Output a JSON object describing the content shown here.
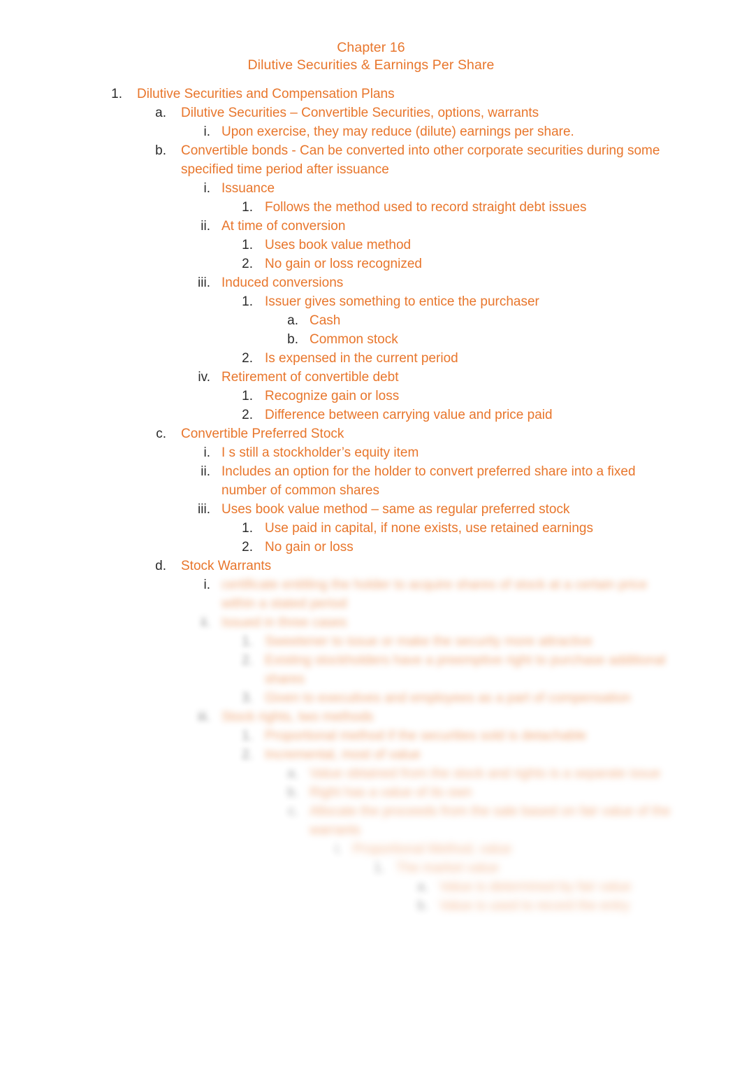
{
  "document": {
    "title_lines": [
      "Chapter 16",
      "Dilutive Securities & Earnings Per Share"
    ],
    "text_color": "#E8762C",
    "marker_color": "#2B2B2B",
    "background_color": "#FFFFFF"
  },
  "outline": [
    {
      "marker": "1.",
      "level": 1,
      "text": "Dilutive Securities and Compensation Plans",
      "blurred": false
    },
    {
      "marker": "a.",
      "level": 2,
      "text": "Dilutive Securities – Convertible Securities, options, warrants",
      "blurred": false
    },
    {
      "marker": "i.",
      "level": 3,
      "text": "Upon exercise, they may reduce (dilute) earnings per share.",
      "blurred": false
    },
    {
      "marker": "b.",
      "level": 2,
      "text": "Convertible bonds - Can be converted into other corporate securities during some specified time period after issuance",
      "blurred": false
    },
    {
      "marker": "i.",
      "level": 3,
      "text": "Issuance",
      "blurred": false
    },
    {
      "marker": "1.",
      "level": 4,
      "text": "Follows the method used to record straight debt issues",
      "blurred": false
    },
    {
      "marker": "ii.",
      "level": 3,
      "text": "At time of conversion",
      "blurred": false
    },
    {
      "marker": "1.",
      "level": 4,
      "text": "Uses book value method",
      "blurred": false
    },
    {
      "marker": "2.",
      "level": 4,
      "text": "No gain or loss recognized",
      "blurred": false
    },
    {
      "marker": "iii.",
      "level": 3,
      "text": "Induced conversions",
      "blurred": false
    },
    {
      "marker": "1.",
      "level": 4,
      "text": "Issuer gives something to entice the purchaser",
      "blurred": false
    },
    {
      "marker": "a.",
      "level": 5,
      "text": "Cash",
      "blurred": false
    },
    {
      "marker": "b.",
      "level": 5,
      "text": "Common stock",
      "blurred": false
    },
    {
      "marker": "2.",
      "level": 4,
      "text": "Is expensed in the current period",
      "blurred": false
    },
    {
      "marker": "iv.",
      "level": 3,
      "text": "Retirement of convertible debt",
      "blurred": false
    },
    {
      "marker": "1.",
      "level": 4,
      "text": "Recognize gain or loss",
      "blurred": false
    },
    {
      "marker": "2.",
      "level": 4,
      "text": "Difference between carrying value and price paid",
      "blurred": false
    },
    {
      "marker": "c.",
      "level": 2,
      "text": "Convertible Preferred Stock",
      "blurred": false
    },
    {
      "marker": "i.",
      "level": 3,
      "text": "I s still a stockholder’s equity item",
      "blurred": false
    },
    {
      "marker": "ii.",
      "level": 3,
      "text": "Includes an option for the holder to convert preferred share into a fixed number of common shares",
      "blurred": false
    },
    {
      "marker": "iii.",
      "level": 3,
      "text": "Uses book value method – same as regular preferred stock",
      "blurred": false
    },
    {
      "marker": "1.",
      "level": 4,
      "text": "Use paid in capital, if none exists, use retained earnings",
      "blurred": false
    },
    {
      "marker": "2.",
      "level": 4,
      "text": "No gain or loss",
      "blurred": false
    },
    {
      "marker": "d.",
      "level": 2,
      "text": "Stock Warrants",
      "blurred": false
    },
    {
      "marker": "i.",
      "level": 3,
      "text": "certificate entitling the holder to acquire shares of stock at a certain price within a stated period",
      "blurred": true,
      "sharp_marker": true
    },
    {
      "marker": "ii.",
      "level": 3,
      "text": "Issued in three cases",
      "blurred": true
    },
    {
      "marker": "1.",
      "level": 4,
      "text": "Sweetener to issue or make the security more attractive",
      "blurred": true
    },
    {
      "marker": "2.",
      "level": 4,
      "text": "Existing stockholders have a preemptive right to purchase additional shares",
      "blurred": true
    },
    {
      "marker": "3.",
      "level": 4,
      "text": "Given to executives and employees as a part of compensation",
      "blurred": true
    },
    {
      "marker": "iii.",
      "level": 3,
      "text": "Stock rights, two methods",
      "blurred": true
    },
    {
      "marker": "1.",
      "level": 4,
      "text": "Proportional method if the securities sold is detachable",
      "blurred": true
    },
    {
      "marker": "2.",
      "level": 4,
      "text": "Incremental, most of value",
      "blurred": true
    },
    {
      "marker": "a.",
      "level": 5,
      "text": "Value obtained from the stock and rights is a separate issue",
      "blurred": true
    },
    {
      "marker": "b.",
      "level": 5,
      "text": "Right has a value of its own",
      "blurred": true
    },
    {
      "marker": "c.",
      "level": 5,
      "text": "Allocate the proceeds from the sale based on fair value of the warrants",
      "blurred": true
    },
    {
      "marker": "i.",
      "level": 6,
      "text": "Proportional Method, value",
      "blurred": true
    },
    {
      "marker": "1.",
      "level": 7,
      "text": "The market value",
      "blurred": true
    },
    {
      "marker": "a.",
      "level": 8,
      "text": "Value is determined by fair value",
      "blurred": true
    },
    {
      "marker": "b.",
      "level": 8,
      "text": "Value is used to record the entry",
      "blurred": true
    }
  ]
}
